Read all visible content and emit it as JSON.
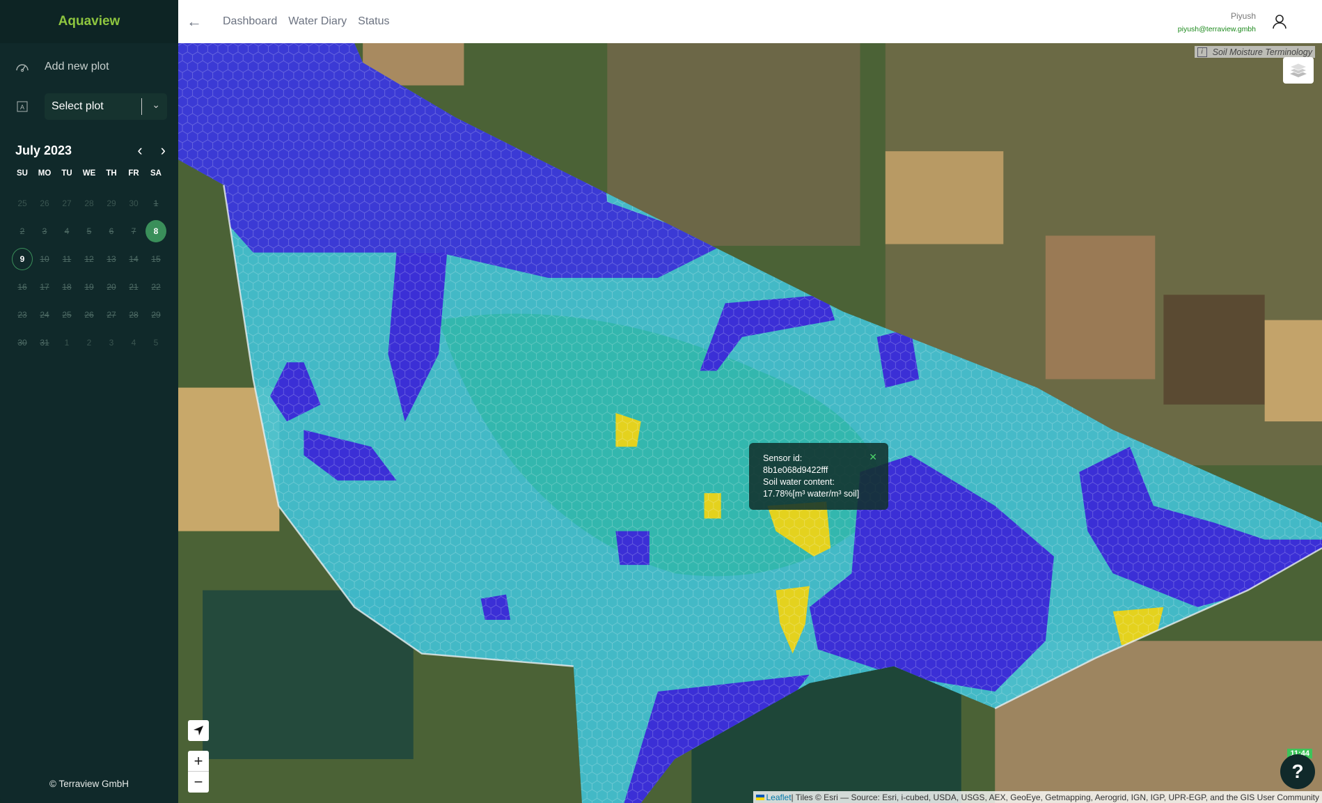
{
  "app": {
    "title": "Aquaview",
    "copyright": "© Terraview GmbH"
  },
  "sidebar": {
    "add_plot": "Add new plot",
    "select_plot": "Select plot",
    "icons": {
      "add": "gauge-icon",
      "select": "plot-frame-icon"
    }
  },
  "calendar": {
    "month": "July 2023",
    "weekdays": [
      "SU",
      "MO",
      "TU",
      "WE",
      "TH",
      "FR",
      "SA"
    ],
    "weeks": [
      [
        "25",
        "26",
        "27",
        "28",
        "29",
        "30",
        "1"
      ],
      [
        "2",
        "3",
        "4",
        "5",
        "6",
        "7",
        "8"
      ],
      [
        "9",
        "10",
        "11",
        "12",
        "13",
        "14",
        "15"
      ],
      [
        "16",
        "17",
        "18",
        "19",
        "20",
        "21",
        "22"
      ],
      [
        "23",
        "24",
        "25",
        "26",
        "27",
        "28",
        "29"
      ],
      [
        "30",
        "31",
        "1",
        "2",
        "3",
        "4",
        "5"
      ]
    ],
    "selected": "8",
    "today": "9"
  },
  "header": {
    "nav": [
      "Dashboard",
      "Water Diary",
      "Status"
    ],
    "user_name": "Piyush",
    "user_email": "piyush@terraview.gmbh"
  },
  "map": {
    "terms_label": "Soil Moisture Terminology",
    "popup": {
      "l1": "Sensor id:",
      "l2": "8b1e068d9422fff",
      "l3": "Soil water content:",
      "l4": "17.78%[m³ water/m³ soil]"
    },
    "zoom_in": "+",
    "zoom_out": "−",
    "attribution_link": "Leaflet",
    "attribution_text": " | Tiles © Esri — Source: Esri, i-cubed, USDA, USGS, AEX, GeoEye, Getmapping, Aerogrid, IGN, IGP, UPR-EGP, and the GIS User Community",
    "clock": "11:44",
    "help": "?",
    "colors": {
      "dry": "#3b2fd6",
      "mid": "#3fc6d8",
      "wet": "#2aa7a6",
      "high": "#e4d21e"
    }
  }
}
